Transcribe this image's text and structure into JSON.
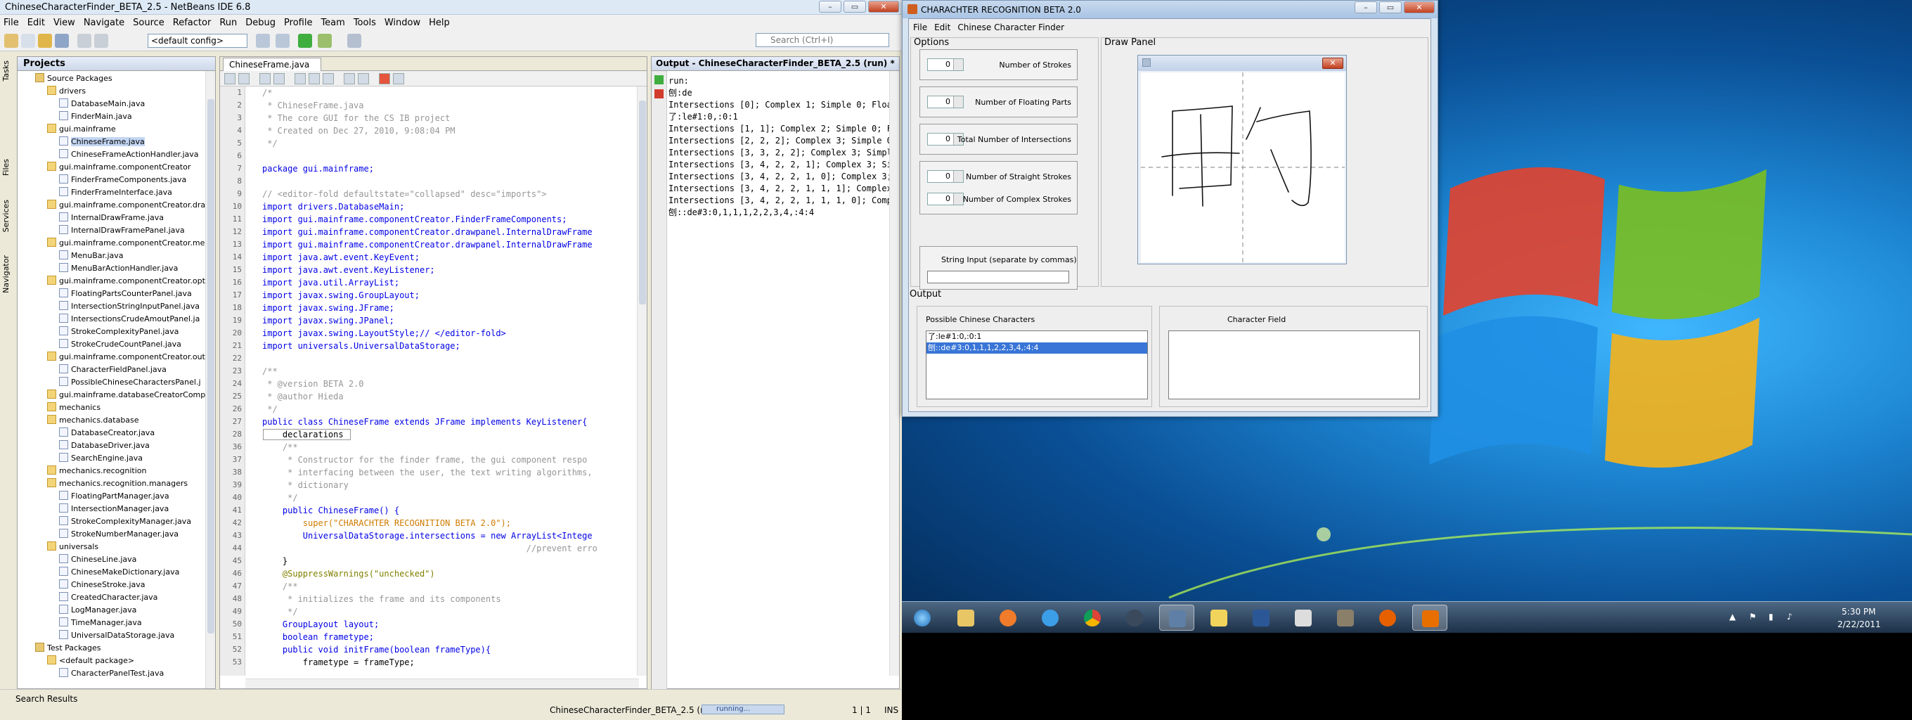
{
  "netbeans": {
    "title": "ChineseCharacterFinder_BETA_2.5 - NetBeans IDE 6.8",
    "menu": [
      "File",
      "Edit",
      "View",
      "Navigate",
      "Source",
      "Refactor",
      "Run",
      "Debug",
      "Profile",
      "Team",
      "Tools",
      "Window",
      "Help"
    ],
    "config": "<default config>",
    "search_placeholder": "Search (Ctrl+I)",
    "side_tabs": [
      "Tasks",
      "Files",
      "Services",
      "Navigator"
    ],
    "projects": {
      "header": "Projects",
      "tree": [
        {
          "label": "Source Packages",
          "indent": 1,
          "type": "pk"
        },
        {
          "label": "drivers",
          "indent": 2,
          "type": "fo"
        },
        {
          "label": "DatabaseMain.java",
          "indent": 3,
          "type": "jv"
        },
        {
          "label": "FinderMain.java",
          "indent": 3,
          "type": "jv"
        },
        {
          "label": "gui.mainframe",
          "indent": 2,
          "type": "fo"
        },
        {
          "label": "ChineseFrame.java",
          "indent": 3,
          "type": "jv",
          "selected": true
        },
        {
          "label": "ChineseFrameActionHandler.java",
          "indent": 3,
          "type": "jv"
        },
        {
          "label": "gui.mainframe.componentCreator",
          "indent": 2,
          "type": "fo"
        },
        {
          "label": "FinderFrameComponents.java",
          "indent": 3,
          "type": "jv"
        },
        {
          "label": "FinderFrameInterface.java",
          "indent": 3,
          "type": "jv"
        },
        {
          "label": "gui.mainframe.componentCreator.dra",
          "indent": 2,
          "type": "fo"
        },
        {
          "label": "InternalDrawFrame.java",
          "indent": 3,
          "type": "jv"
        },
        {
          "label": "InternalDrawFramePanel.java",
          "indent": 3,
          "type": "jv"
        },
        {
          "label": "gui.mainframe.componentCreator.mer",
          "indent": 2,
          "type": "fo"
        },
        {
          "label": "MenuBar.java",
          "indent": 3,
          "type": "jv"
        },
        {
          "label": "MenuBarActionHandler.java",
          "indent": 3,
          "type": "jv"
        },
        {
          "label": "gui.mainframe.componentCreator.opt",
          "indent": 2,
          "type": "fo"
        },
        {
          "label": "FloatingPartsCounterPanel.java",
          "indent": 3,
          "type": "jv"
        },
        {
          "label": "IntersectionStringInputPanel.java",
          "indent": 3,
          "type": "jv"
        },
        {
          "label": "IntersectionsCrudeAmoutPanel.ja",
          "indent": 3,
          "type": "jv"
        },
        {
          "label": "StrokeComplexityPanel.java",
          "indent": 3,
          "type": "jv"
        },
        {
          "label": "StrokeCrudeCountPanel.java",
          "indent": 3,
          "type": "jv"
        },
        {
          "label": "gui.mainframe.componentCreator.out",
          "indent": 2,
          "type": "fo"
        },
        {
          "label": "CharacterFieldPanel.java",
          "indent": 3,
          "type": "jv"
        },
        {
          "label": "PossibleChineseCharactersPanel.j",
          "indent": 3,
          "type": "jv"
        },
        {
          "label": "gui.mainframe.databaseCreatorComp",
          "indent": 2,
          "type": "fo"
        },
        {
          "label": "mechanics",
          "indent": 2,
          "type": "fo"
        },
        {
          "label": "mechanics.database",
          "indent": 2,
          "type": "fo"
        },
        {
          "label": "DatabaseCreator.java",
          "indent": 3,
          "type": "jv"
        },
        {
          "label": "DatabaseDriver.java",
          "indent": 3,
          "type": "jv"
        },
        {
          "label": "SearchEngine.java",
          "indent": 3,
          "type": "jv"
        },
        {
          "label": "mechanics.recognition",
          "indent": 2,
          "type": "fo"
        },
        {
          "label": "mechanics.recognition.managers",
          "indent": 2,
          "type": "fo"
        },
        {
          "label": "FloatingPartManager.java",
          "indent": 3,
          "type": "jv"
        },
        {
          "label": "IntersectionManager.java",
          "indent": 3,
          "type": "jv"
        },
        {
          "label": "StrokeComplexityManager.java",
          "indent": 3,
          "type": "jv"
        },
        {
          "label": "StrokeNumberManager.java",
          "indent": 3,
          "type": "jv"
        },
        {
          "label": "universals",
          "indent": 2,
          "type": "fo"
        },
        {
          "label": "ChineseLine.java",
          "indent": 3,
          "type": "jv"
        },
        {
          "label": "ChineseMakeDictionary.java",
          "indent": 3,
          "type": "jv"
        },
        {
          "label": "ChineseStroke.java",
          "indent": 3,
          "type": "jv"
        },
        {
          "label": "CreatedCharacter.java",
          "indent": 3,
          "type": "jv"
        },
        {
          "label": "LogManager.java",
          "indent": 3,
          "type": "jv"
        },
        {
          "label": "TimeManager.java",
          "indent": 3,
          "type": "jv"
        },
        {
          "label": "UniversalDataStorage.java",
          "indent": 3,
          "type": "jv"
        },
        {
          "label": "Test Packages",
          "indent": 1,
          "type": "pk"
        },
        {
          "label": "<default package>",
          "indent": 2,
          "type": "fo"
        },
        {
          "label": "CharacterPanelTest.java",
          "indent": 3,
          "type": "jv"
        }
      ]
    },
    "editor": {
      "tab": "ChineseFrame.java",
      "lines": [
        {
          "n": "1",
          "t": "/*",
          "c": "cm"
        },
        {
          "n": "2",
          "t": " * ChineseFrame.java",
          "c": "cm"
        },
        {
          "n": "3",
          "t": " * The core GUI for the CS IB project",
          "c": "cm"
        },
        {
          "n": "4",
          "t": " * Created on Dec 27, 2010, 9:08:04 PM",
          "c": "cm"
        },
        {
          "n": "5",
          "t": " */",
          "c": "cm"
        },
        {
          "n": "6",
          "t": "",
          "c": ""
        },
        {
          "n": "7",
          "t": "package gui.mainframe;",
          "c": "kwl"
        },
        {
          "n": "8",
          "t": "",
          "c": ""
        },
        {
          "n": "9",
          "t": "// <editor-fold defaultstate=\"collapsed\" desc=\"imports\">",
          "c": "cm"
        },
        {
          "n": "10",
          "t": "import drivers.DatabaseMain;",
          "c": "imp"
        },
        {
          "n": "11",
          "t": "import gui.mainframe.componentCreator.FinderFrameComponents;",
          "c": "imp"
        },
        {
          "n": "12",
          "t": "import gui.mainframe.componentCreator.drawpanel.InternalDrawFrame",
          "c": "imp"
        },
        {
          "n": "13",
          "t": "import gui.mainframe.componentCreator.drawpanel.InternalDrawFrame",
          "c": "imp"
        },
        {
          "n": "14",
          "t": "import java.awt.event.KeyEvent;",
          "c": "imp"
        },
        {
          "n": "15",
          "t": "import java.awt.event.KeyListener;",
          "c": "imp"
        },
        {
          "n": "16",
          "t": "import java.util.ArrayList;",
          "c": "imp"
        },
        {
          "n": "17",
          "t": "import javax.swing.GroupLayout;",
          "c": "imp"
        },
        {
          "n": "18",
          "t": "import javax.swing.JFrame;",
          "c": "imp"
        },
        {
          "n": "19",
          "t": "import javax.swing.JPanel;",
          "c": "imp"
        },
        {
          "n": "20",
          "t": "import javax.swing.LayoutStyle;// </editor-fold>",
          "c": "imp"
        },
        {
          "n": "21",
          "t": "import universals.UniversalDataStorage;",
          "c": "imp"
        },
        {
          "n": "22",
          "t": "",
          "c": ""
        },
        {
          "n": "23",
          "t": "/**",
          "c": "cm"
        },
        {
          "n": "24",
          "t": " * @version BETA 2.0",
          "c": "cm"
        },
        {
          "n": "25",
          "t": " * @author Hieda",
          "c": "cm"
        },
        {
          "n": "26",
          "t": " */",
          "c": "cm"
        },
        {
          "n": "27",
          "t": "public class ChineseFrame extends JFrame implements KeyListener{",
          "c": "kwl"
        },
        {
          "n": "28",
          "t": "    declarations ",
          "c": "fold"
        },
        {
          "n": "36",
          "t": "    /**",
          "c": "cm"
        },
        {
          "n": "37",
          "t": "     * Constructor for the finder frame, the gui component respo",
          "c": "cm"
        },
        {
          "n": "38",
          "t": "     * interfacing between the user, the text writing algorithms,",
          "c": "cm"
        },
        {
          "n": "39",
          "t": "     * dictionary",
          "c": "cm"
        },
        {
          "n": "40",
          "t": "     */",
          "c": "cm"
        },
        {
          "n": "41",
          "t": "    public ChineseFrame() {",
          "c": "kwl"
        },
        {
          "n": "42",
          "t": "        super(\"CHARACHTER RECOGNITION BETA 2.0\");",
          "c": "st"
        },
        {
          "n": "43",
          "t": "        UniversalDataStorage.intersections = new ArrayList<Intege",
          "c": "kwl"
        },
        {
          "n": "44",
          "t": "                                                    //prevent erro",
          "c": "cm"
        },
        {
          "n": "45",
          "t": "    }",
          "c": ""
        },
        {
          "n": "46",
          "t": "    @SuppressWarnings(\"unchecked\")",
          "c": "an"
        },
        {
          "n": "47",
          "t": "    /**",
          "c": "cm"
        },
        {
          "n": "48",
          "t": "     * initializes the frame and its components",
          "c": "cm"
        },
        {
          "n": "49",
          "t": "     */",
          "c": "cm"
        },
        {
          "n": "50",
          "t": "    GroupLayout layout;",
          "c": "kwl"
        },
        {
          "n": "51",
          "t": "    boolean frametype;",
          "c": "kwl"
        },
        {
          "n": "52",
          "t": "    public void initFrame(boolean frameType){",
          "c": "kwl"
        },
        {
          "n": "53",
          "t": "        frametype = frameType;",
          "c": ""
        }
      ]
    },
    "output": {
      "header": "Output - ChineseCharacterFinder_BETA_2.5 (run) *",
      "lines": [
        "run:",
        "刨:de",
        "Intersections [0]; Complex 1; Simple 0; Floa",
        "了:le#1:0,:0:1",
        "Intersections [1, 1]; Complex 2; Simple 0; F",
        "Intersections [2, 2, 2]; Complex 3; Simple 0",
        "Intersections [3, 3, 2, 2]; Complex 3; Simpl",
        "Intersections [3, 4, 2, 2, 1]; Complex 3; Si",
        "Intersections [3, 4, 2, 2, 1, 0]; Complex 3;",
        "Intersections [3, 4, 2, 2, 1, 1, 1]; Complex",
        "Intersections [3, 4, 2, 2, 1, 1, 1, 0]; Comp",
        "刨::de#3:0,1,1,1,2,2,3,4,:4:4"
      ]
    },
    "status": {
      "left": "Search Results",
      "task": "ChineseCharacterFinder_BETA_2.5 (run)",
      "progress": "running...",
      "pos": "1 | 1",
      "mode": "INS"
    }
  },
  "app": {
    "title": "CHARACHTER RECOGNITION BETA 2.0",
    "menu": [
      "File",
      "Edit",
      "Chinese Character Finder"
    ],
    "options_label": "Options",
    "draw_label": "Draw Panel",
    "output_label": "Output",
    "options": [
      {
        "value": "0",
        "label": "Number of Strokes"
      },
      {
        "value": "0",
        "label": "Number of Floating Parts"
      },
      {
        "value": "0",
        "label": "Total Number of Intersections"
      },
      {
        "value": "0",
        "label": "Number of Straight Strokes"
      },
      {
        "value": "0",
        "label": "Number of Complex Strokes"
      }
    ],
    "string_input_label": "String Input (separate by commas)",
    "string_input_value": "",
    "possible_label": "Possible Chinese Characters",
    "possible_items": [
      {
        "text": "了:le#1:0,:0:1",
        "selected": false
      },
      {
        "text": "刨::de#3:0,1,1,1,2,2,3,4,:4:4",
        "selected": true
      }
    ],
    "character_field_label": "Character Field"
  },
  "taskbar": {
    "time": "5:30 PM",
    "date": "2/22/2011"
  }
}
